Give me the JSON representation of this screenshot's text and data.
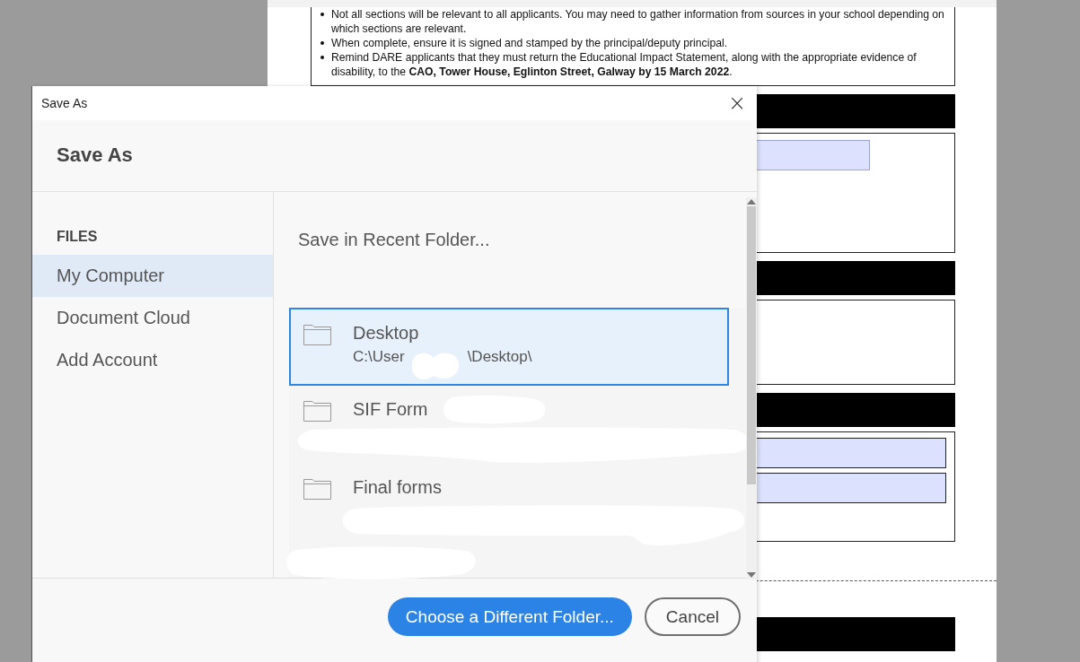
{
  "document": {
    "bullets": [
      "Not all sections will be relevant to all applicants. You may need to gather information from sources in your school depending on which sections are relevant.",
      "When complete, ensure it is signed and stamped by the principal/deputy principal.",
      "Remind DARE applicants that they must return the Educational Impact Statement, along with the appropriate evidence of disability, to the **CAO, Tower House, Eglinton Street, Galway by 15 March 2022**."
    ]
  },
  "dialog": {
    "title": "Save As",
    "close": "×",
    "heading": "Save As",
    "sidebar": {
      "section": "FILES",
      "items": [
        {
          "label": "My Computer",
          "selected": true
        },
        {
          "label": "Document Cloud",
          "selected": false
        },
        {
          "label": "Add Account",
          "selected": false
        }
      ]
    },
    "recent_heading": "Save in Recent Folder...",
    "folders": [
      {
        "name": "Desktop",
        "path": [
          "C:\\User",
          "\\Desktop\\"
        ],
        "selected": true
      },
      {
        "name": "SIF Form",
        "selected": false
      },
      {
        "name": "Final forms",
        "selected": false
      }
    ],
    "buttons": [
      {
        "label": "Choose a Different Folder...",
        "kind": "primary"
      },
      {
        "label": "Cancel",
        "kind": "secondary"
      }
    ]
  }
}
